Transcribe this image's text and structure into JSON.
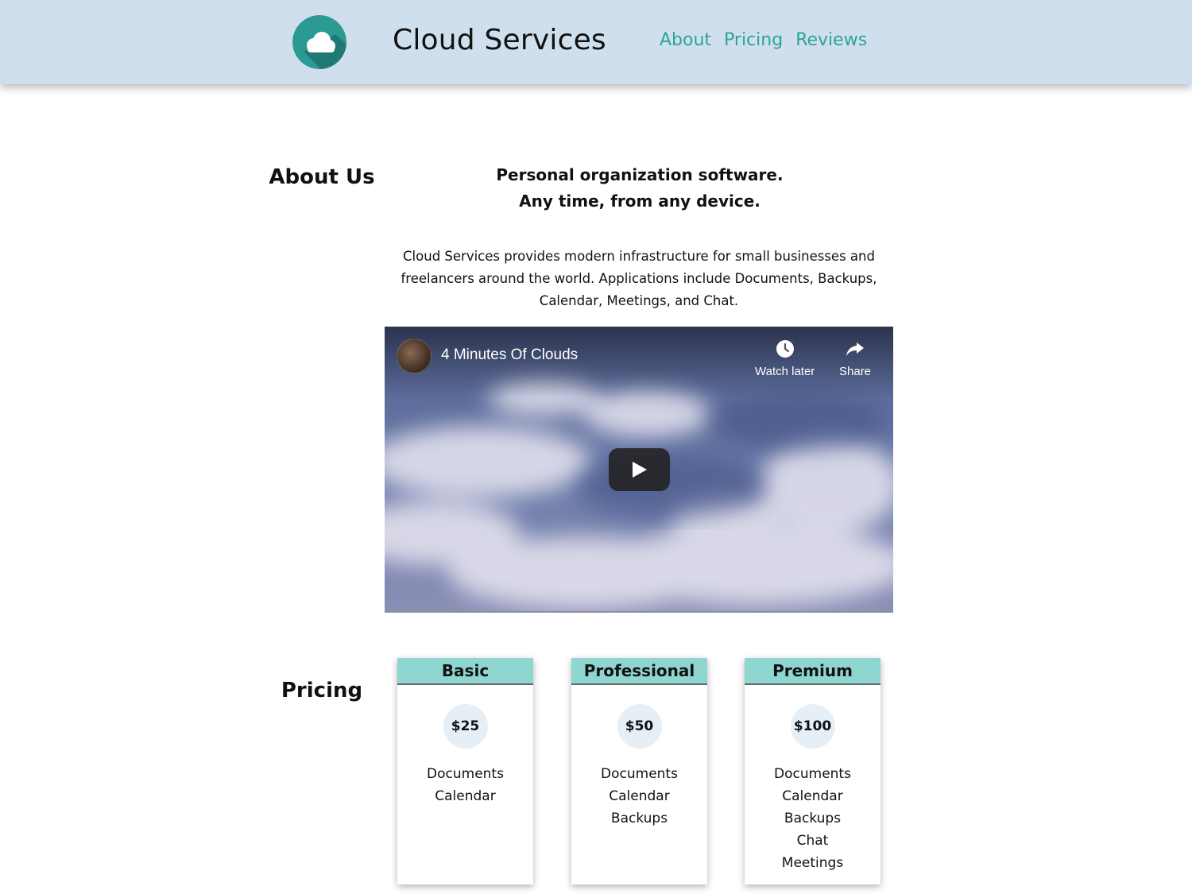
{
  "header": {
    "brand": "Cloud Services",
    "logo_icon": "cloud-icon",
    "nav": [
      {
        "label": "About"
      },
      {
        "label": "Pricing"
      },
      {
        "label": "Reviews"
      }
    ],
    "accent_color": "#2aa59a",
    "background_color": "#d0dfee"
  },
  "about": {
    "title": "About Us",
    "tagline_line1": "Personal organization software.",
    "tagline_line2": "Any time, from any device.",
    "description": "Cloud Services provides modern infrastructure for small businesses and freelancers around the world. Applications include Documents, Backups, Calendar, Meetings, and Chat."
  },
  "video": {
    "title": "4 Minutes Of Clouds",
    "watch_later_label": "Watch later",
    "share_label": "Share",
    "watch_later_icon": "clock-icon",
    "share_icon": "share-arrow-icon",
    "play_icon": "play-icon"
  },
  "pricing": {
    "title": "Pricing",
    "header_color": "#8ed6cf",
    "plans": [
      {
        "name": "Basic",
        "price": "$25",
        "features": [
          "Documents",
          "Calendar"
        ]
      },
      {
        "name": "Professional",
        "price": "$50",
        "features": [
          "Documents",
          "Calendar",
          "Backups"
        ]
      },
      {
        "name": "Premium",
        "price": "$100",
        "features": [
          "Documents",
          "Calendar",
          "Backups",
          "Chat",
          "Meetings"
        ]
      }
    ]
  }
}
